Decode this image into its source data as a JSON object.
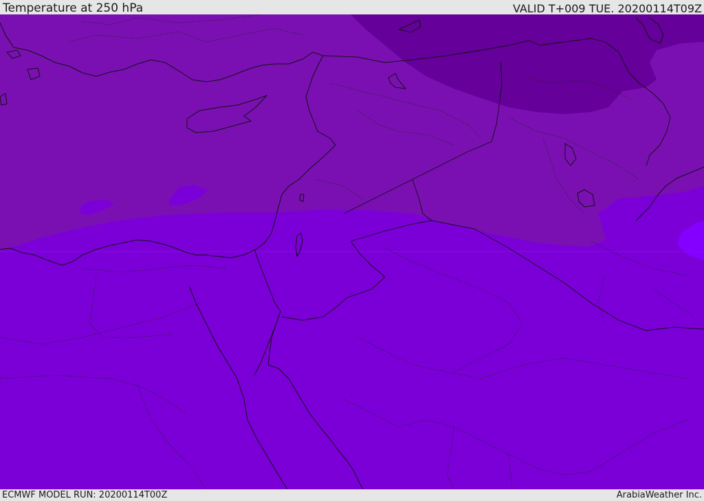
{
  "header": {
    "title": "Temperature at 250 hPa",
    "valid": "VALID T+009 TUE. 20200114T09Z"
  },
  "footer": {
    "model_run": "ECMWF MODEL RUN: 20200114T00Z",
    "credit": "ArabiaWeather Inc."
  },
  "colors": {
    "band_warm": "#7b00d8",
    "band_mid": "#7a10b2",
    "band_cold": "#65009a",
    "band_warmest": "#8400ff",
    "coastline": "#111111",
    "border": "#111111"
  }
}
